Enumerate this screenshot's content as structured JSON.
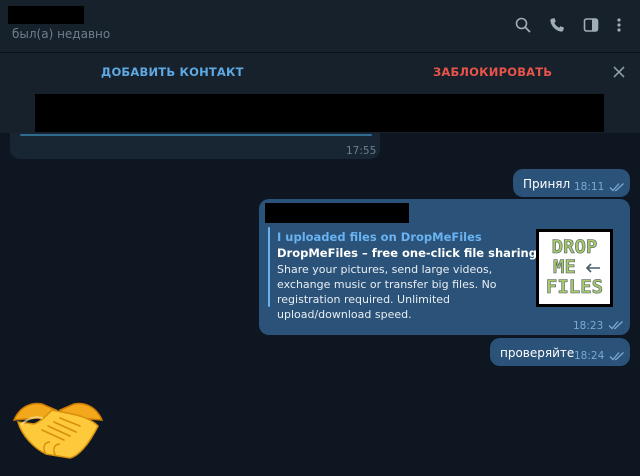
{
  "header": {
    "status": "был(а) недавно",
    "icons": [
      "search-icon",
      "phone-icon",
      "sidebar-toggle-icon",
      "more-vertical-icon"
    ]
  },
  "actions": {
    "add_contact": "ДОБАВИТЬ КОНТАКТ",
    "block": "ЗАБЛОКИРОВАТЬ"
  },
  "messages": {
    "incoming_time": "17:55",
    "accepted": {
      "text": "Принял",
      "time": "18:11"
    },
    "link": {
      "site": "I uploaded files on DropMeFiles",
      "title": "DropMeFiles – free one-click file sharing service",
      "description": "Share your pictures, send large videos, exchange music or transfer big files. No registration required. Unlimited upload/download speed.",
      "time": "18:23",
      "thumbnail": {
        "line1": "DROP",
        "line2": "ME",
        "line3": "FILES"
      }
    },
    "check": {
      "text": "проверяйте",
      "time": "18:24"
    }
  },
  "sticker": "handshake-emoji",
  "colors": {
    "background": "#0e1621",
    "panel": "#17212b",
    "incoming_bubble": "#182533",
    "outgoing_bubble": "#2b5278",
    "accent": "#6ab3f3",
    "danger": "#e8534a"
  }
}
